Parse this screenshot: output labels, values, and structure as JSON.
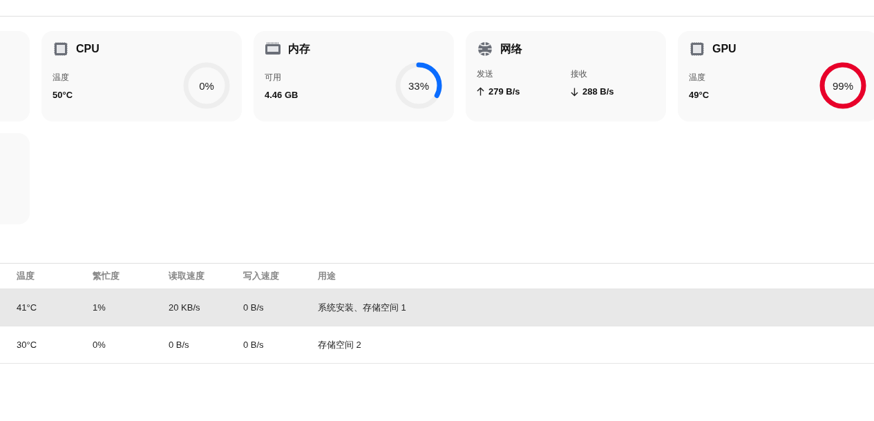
{
  "cards": [
    {
      "kind": "gauge",
      "title": "CPU",
      "stat_label": "温度",
      "stat_value": "50°C",
      "gauge": {
        "level": 0,
        "reading": "0%"
      }
    },
    {
      "kind": "gauge",
      "title": "内存",
      "stat_label": "可用",
      "stat_value": "4.46 GB",
      "gauge": {
        "level": 0.33,
        "reading": "33%",
        "color": "#0a6cff"
      }
    },
    {
      "kind": "network",
      "title": "网络",
      "send_label": "发送",
      "send_value": "279 B/s",
      "recv_label": "接收",
      "recv_value": "288 B/s"
    },
    {
      "kind": "gauge",
      "title": "GPU",
      "stat_label": "温度",
      "stat_value": "49°C",
      "gauge": {
        "level": 0.99,
        "reading": "99%",
        "color": "#e8002a"
      }
    }
  ],
  "disk_table": {
    "columns": [
      "温度",
      "繁忙度",
      "读取速度",
      "写入速度",
      "用途"
    ],
    "rows": [
      {
        "selected": true,
        "cells": [
          "41°C",
          "1%",
          "20 KB/s",
          "0 B/s",
          "系统安装、存储空间 1"
        ]
      },
      {
        "selected": false,
        "cells": [
          "30°C",
          "0%",
          "0 B/s",
          "0 B/s",
          "存储空间 2"
        ]
      }
    ]
  }
}
